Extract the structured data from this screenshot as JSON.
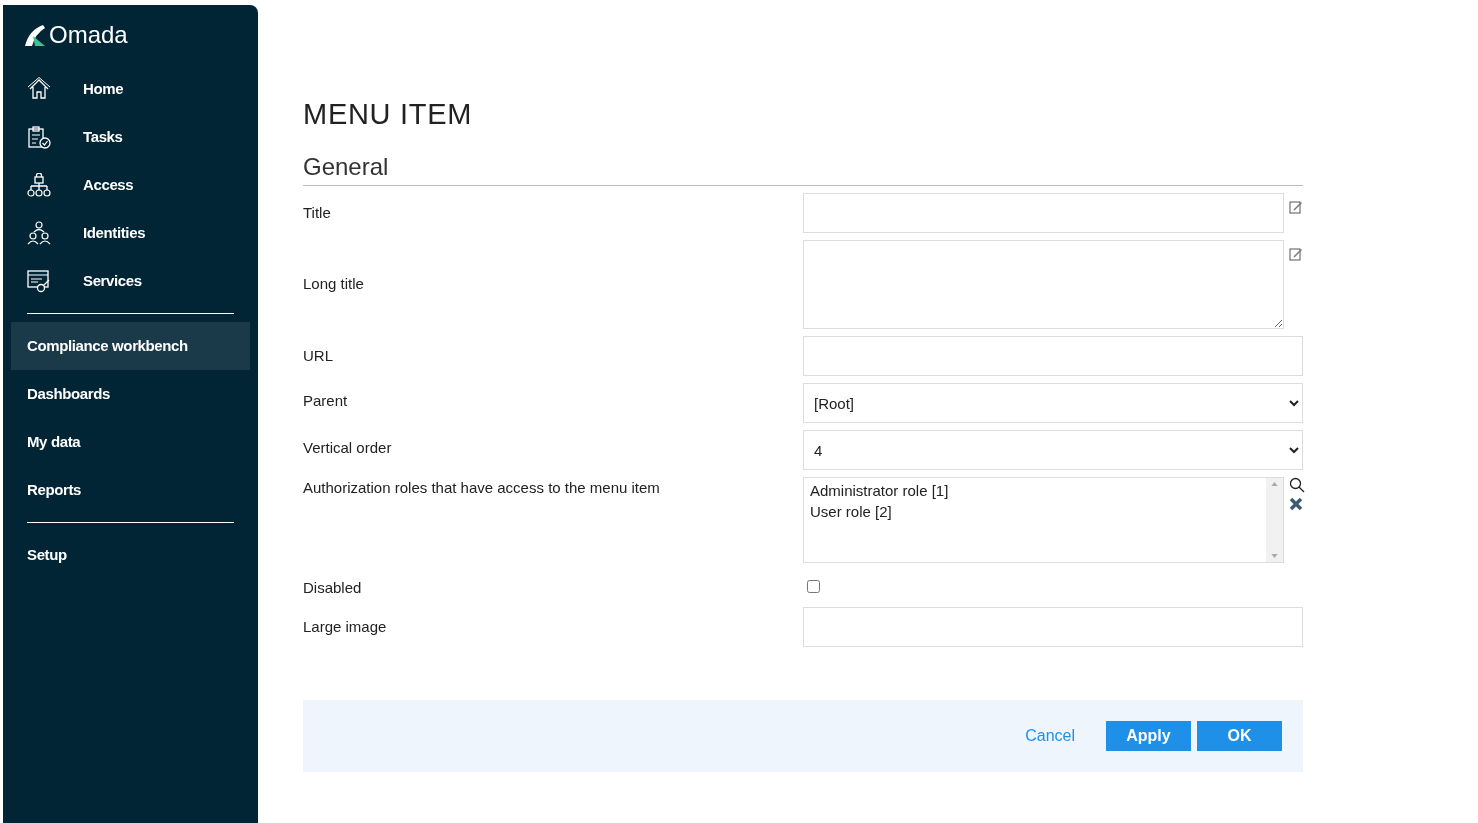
{
  "sidebar": {
    "logo": "Omada",
    "nav_groups": [
      [
        {
          "label": "Home",
          "selected": false
        },
        {
          "label": "Tasks",
          "selected": false
        },
        {
          "label": "Access",
          "selected": false
        },
        {
          "label": "Identities",
          "selected": false
        },
        {
          "label": "Services",
          "selected": false
        }
      ],
      [
        {
          "label": "Compliance workbench",
          "selected": true
        },
        {
          "label": "Dashboards",
          "selected": false
        },
        {
          "label": "My data",
          "selected": false
        },
        {
          "label": "Reports",
          "selected": false
        }
      ],
      [
        {
          "label": "Setup",
          "selected": false
        }
      ]
    ]
  },
  "page": {
    "title": "MENU ITEM",
    "section": "General",
    "fields": [
      {
        "kind": "text",
        "label": "Title",
        "edit_icon": true
      },
      {
        "kind": "textarea",
        "label": "Long title",
        "edit_icon": true
      },
      {
        "kind": "text",
        "label": "URL"
      },
      {
        "kind": "select",
        "label": "Parent",
        "value": "[Root]"
      },
      {
        "kind": "select",
        "label": "Vertical order",
        "value": "4"
      },
      {
        "kind": "listbox",
        "label": "Authorization roles that have access to the menu item",
        "items": [
          "Administrator role [1]",
          "User role [2]"
        ]
      },
      {
        "kind": "checkbox",
        "label": "Disabled",
        "checked": false
      },
      {
        "kind": "text",
        "label": "Large image"
      }
    ]
  },
  "footer": {
    "cancel": "Cancel",
    "buttons": [
      "Apply",
      "OK"
    ]
  }
}
